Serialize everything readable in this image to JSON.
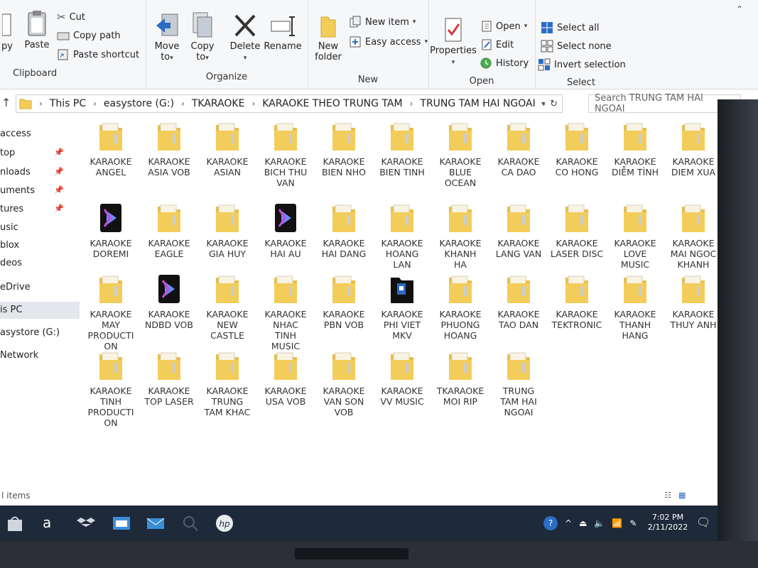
{
  "ribbon": {
    "clipboard": {
      "group_label": "Clipboard",
      "copy_label": "py",
      "paste_label": "Paste",
      "cut_label": "Cut",
      "copy_path_label": "Copy path",
      "paste_shortcut_label": "Paste shortcut"
    },
    "organize": {
      "group_label": "Organize",
      "move_to_label": "Move",
      "move_to_sub": "to",
      "copy_to_label": "Copy",
      "copy_to_sub": "to",
      "delete_label": "Delete",
      "rename_label": "Rename"
    },
    "new": {
      "group_label": "New",
      "new_folder_label": "New",
      "new_folder_sub": "folder",
      "new_item_label": "New item",
      "easy_access_label": "Easy access"
    },
    "open": {
      "group_label": "Open",
      "properties_label": "Properties",
      "open_label": "Open",
      "edit_label": "Edit",
      "history_label": "History"
    },
    "select": {
      "group_label": "Select",
      "select_all_label": "Select all",
      "select_none_label": "Select none",
      "invert_selection_label": "Invert selection"
    }
  },
  "address": {
    "crumbs": [
      "This PC",
      "easystore (G:)",
      "TKARAOKE",
      "KARAOKE THEO TRUNG TAM",
      "TRUNG TAM HAI NGOAI"
    ],
    "search_placeholder": "Search TRUNG TAM HAI NGOAI"
  },
  "nav": {
    "items": [
      "access",
      "top",
      "nloads",
      "uments",
      "tures",
      "usic",
      "blox",
      "deos",
      "eDrive",
      "is PC",
      "asystore (G:)",
      "Network"
    ]
  },
  "folders": [
    {
      "line1": "KARAOKE",
      "line2": "ANGEL",
      "line3": "",
      "line4": ""
    },
    {
      "line1": "KARAOKE",
      "line2": "ASIA VOB",
      "line3": "",
      "line4": ""
    },
    {
      "line1": "KARAOKE",
      "line2": "ASIAN",
      "line3": "",
      "line4": ""
    },
    {
      "line1": "KARAOKE",
      "line2": "BICH THU",
      "line3": "VAN",
      "line4": ""
    },
    {
      "line1": "KARAOKE",
      "line2": "BIEN NHO",
      "line3": "",
      "line4": ""
    },
    {
      "line1": "KARAOKE",
      "line2": "BIEN TINH",
      "line3": "",
      "line4": ""
    },
    {
      "line1": "KARAOKE",
      "line2": "BLUE",
      "line3": "OCEAN",
      "line4": ""
    },
    {
      "line1": "KARAOKE",
      "line2": "CA DAO",
      "line3": "",
      "line4": ""
    },
    {
      "line1": "KARAOKE",
      "line2": "CO HONG",
      "line3": "",
      "line4": ""
    },
    {
      "line1": "KARAOKE",
      "line2": "DIỄM TÌNH",
      "line3": "",
      "line4": ""
    },
    {
      "line1": "KARAOKE",
      "line2": "DIEM XUA",
      "line3": "",
      "line4": ""
    },
    {
      "line1": "KARAOKE",
      "line2": "DOREMI",
      "line3": "",
      "line4": ""
    },
    {
      "line1": "KARAOKE",
      "line2": "EAGLE",
      "line3": "",
      "line4": ""
    },
    {
      "line1": "KARAOKE",
      "line2": "GIA HUY",
      "line3": "",
      "line4": ""
    },
    {
      "line1": "KARAOKE",
      "line2": "HAI AU",
      "line3": "",
      "line4": ""
    },
    {
      "line1": "KARAOKE",
      "line2": "HAI DANG",
      "line3": "",
      "line4": ""
    },
    {
      "line1": "KARAOKE",
      "line2": "HOANG",
      "line3": "LAN",
      "line4": ""
    },
    {
      "line1": "KARAOKE",
      "line2": "KHANH",
      "line3": "HA",
      "line4": ""
    },
    {
      "line1": "KARAOKE",
      "line2": "LANG VAN",
      "line3": "",
      "line4": ""
    },
    {
      "line1": "KARAOKE",
      "line2": "LASER DISC",
      "line3": "",
      "line4": ""
    },
    {
      "line1": "KARAOKE",
      "line2": "LOVE",
      "line3": "MUSIC",
      "line4": ""
    },
    {
      "line1": "KARAOKE",
      "line2": "MAI NGOC",
      "line3": "KHANH",
      "line4": ""
    },
    {
      "line1": "KARAOKE",
      "line2": "MAY",
      "line3": "PRODUCTI",
      "line4": "ON"
    },
    {
      "line1": "KARAOKE",
      "line2": "NDBD VOB",
      "line3": "",
      "line4": ""
    },
    {
      "line1": "KARAOKE",
      "line2": "NEW",
      "line3": "CASTLE",
      "line4": ""
    },
    {
      "line1": "KARAOKE",
      "line2": "NHAC",
      "line3": "TINH",
      "line4": "MUSIC"
    },
    {
      "line1": "KARAOKE",
      "line2": "PBN VOB",
      "line3": "",
      "line4": ""
    },
    {
      "line1": "KARAOKE",
      "line2": "PHI VIET",
      "line3": "MKV",
      "line4": ""
    },
    {
      "line1": "KARAOKE",
      "line2": "PHUONG",
      "line3": "HOANG",
      "line4": ""
    },
    {
      "line1": "KARAOKE",
      "line2": "TAO DAN",
      "line3": "",
      "line4": ""
    },
    {
      "line1": "KARAOKE",
      "line2": "TEKTRONIC",
      "line3": "",
      "line4": ""
    },
    {
      "line1": "KARAOKE",
      "line2": "THANH",
      "line3": "HANG",
      "line4": ""
    },
    {
      "line1": "KARAOKE",
      "line2": "THUY ANH",
      "line3": "",
      "line4": ""
    },
    {
      "line1": "KARAOKE",
      "line2": "TINH",
      "line3": "PRODUCTI",
      "line4": "ON"
    },
    {
      "line1": "KARAOKE",
      "line2": "TOP LASER",
      "line3": "",
      "line4": ""
    },
    {
      "line1": "KARAOKE",
      "line2": "TRUNG",
      "line3": "TAM KHAC",
      "line4": ""
    },
    {
      "line1": "KARAOKE",
      "line2": "USA VOB",
      "line3": "",
      "line4": ""
    },
    {
      "line1": "KARAOKE",
      "line2": "VAN SON",
      "line3": "VOB",
      "line4": ""
    },
    {
      "line1": "KARAOKE",
      "line2": "VV MUSIC",
      "line3": "",
      "line4": ""
    },
    {
      "line1": "TKARAOKE",
      "line2": "MOI RIP",
      "line3": "",
      "line4": ""
    },
    {
      "line1": "TRUNG",
      "line2": "TAM HAI",
      "line3": "NGOAI",
      "line4": ""
    }
  ],
  "status": {
    "items_text": "l items"
  },
  "taskbar": {
    "time": "7:02 PM",
    "date": "2/11/2022",
    "search_glyph": "a"
  },
  "colors": {
    "folder": "#f3cd5a",
    "folder_dark": "#e3b53b",
    "taskbar": "#1e2a3a",
    "accent": "#2b6cc4"
  }
}
